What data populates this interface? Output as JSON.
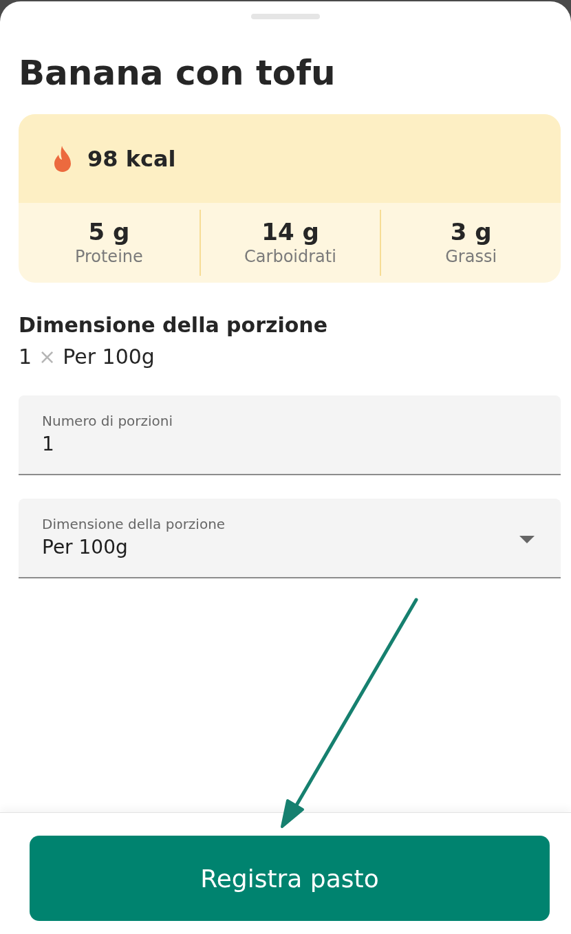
{
  "title": "Banana con tofu",
  "nutrition": {
    "calories": "98 kcal",
    "macros": [
      {
        "value": "5 g",
        "label": "Proteine"
      },
      {
        "value": "14 g",
        "label": "Carboidrati"
      },
      {
        "value": "3 g",
        "label": "Grassi"
      }
    ]
  },
  "serving": {
    "heading": "Dimensione della porzione",
    "count": "1",
    "sign": "×",
    "unit": "Per 100g"
  },
  "fields": [
    {
      "kind": "text",
      "label": "Numero di porzioni",
      "value": "1"
    },
    {
      "kind": "select",
      "label": "Dimensione della porzione",
      "value": "Per 100g"
    }
  ],
  "button": {
    "label": "Registra pasto"
  }
}
